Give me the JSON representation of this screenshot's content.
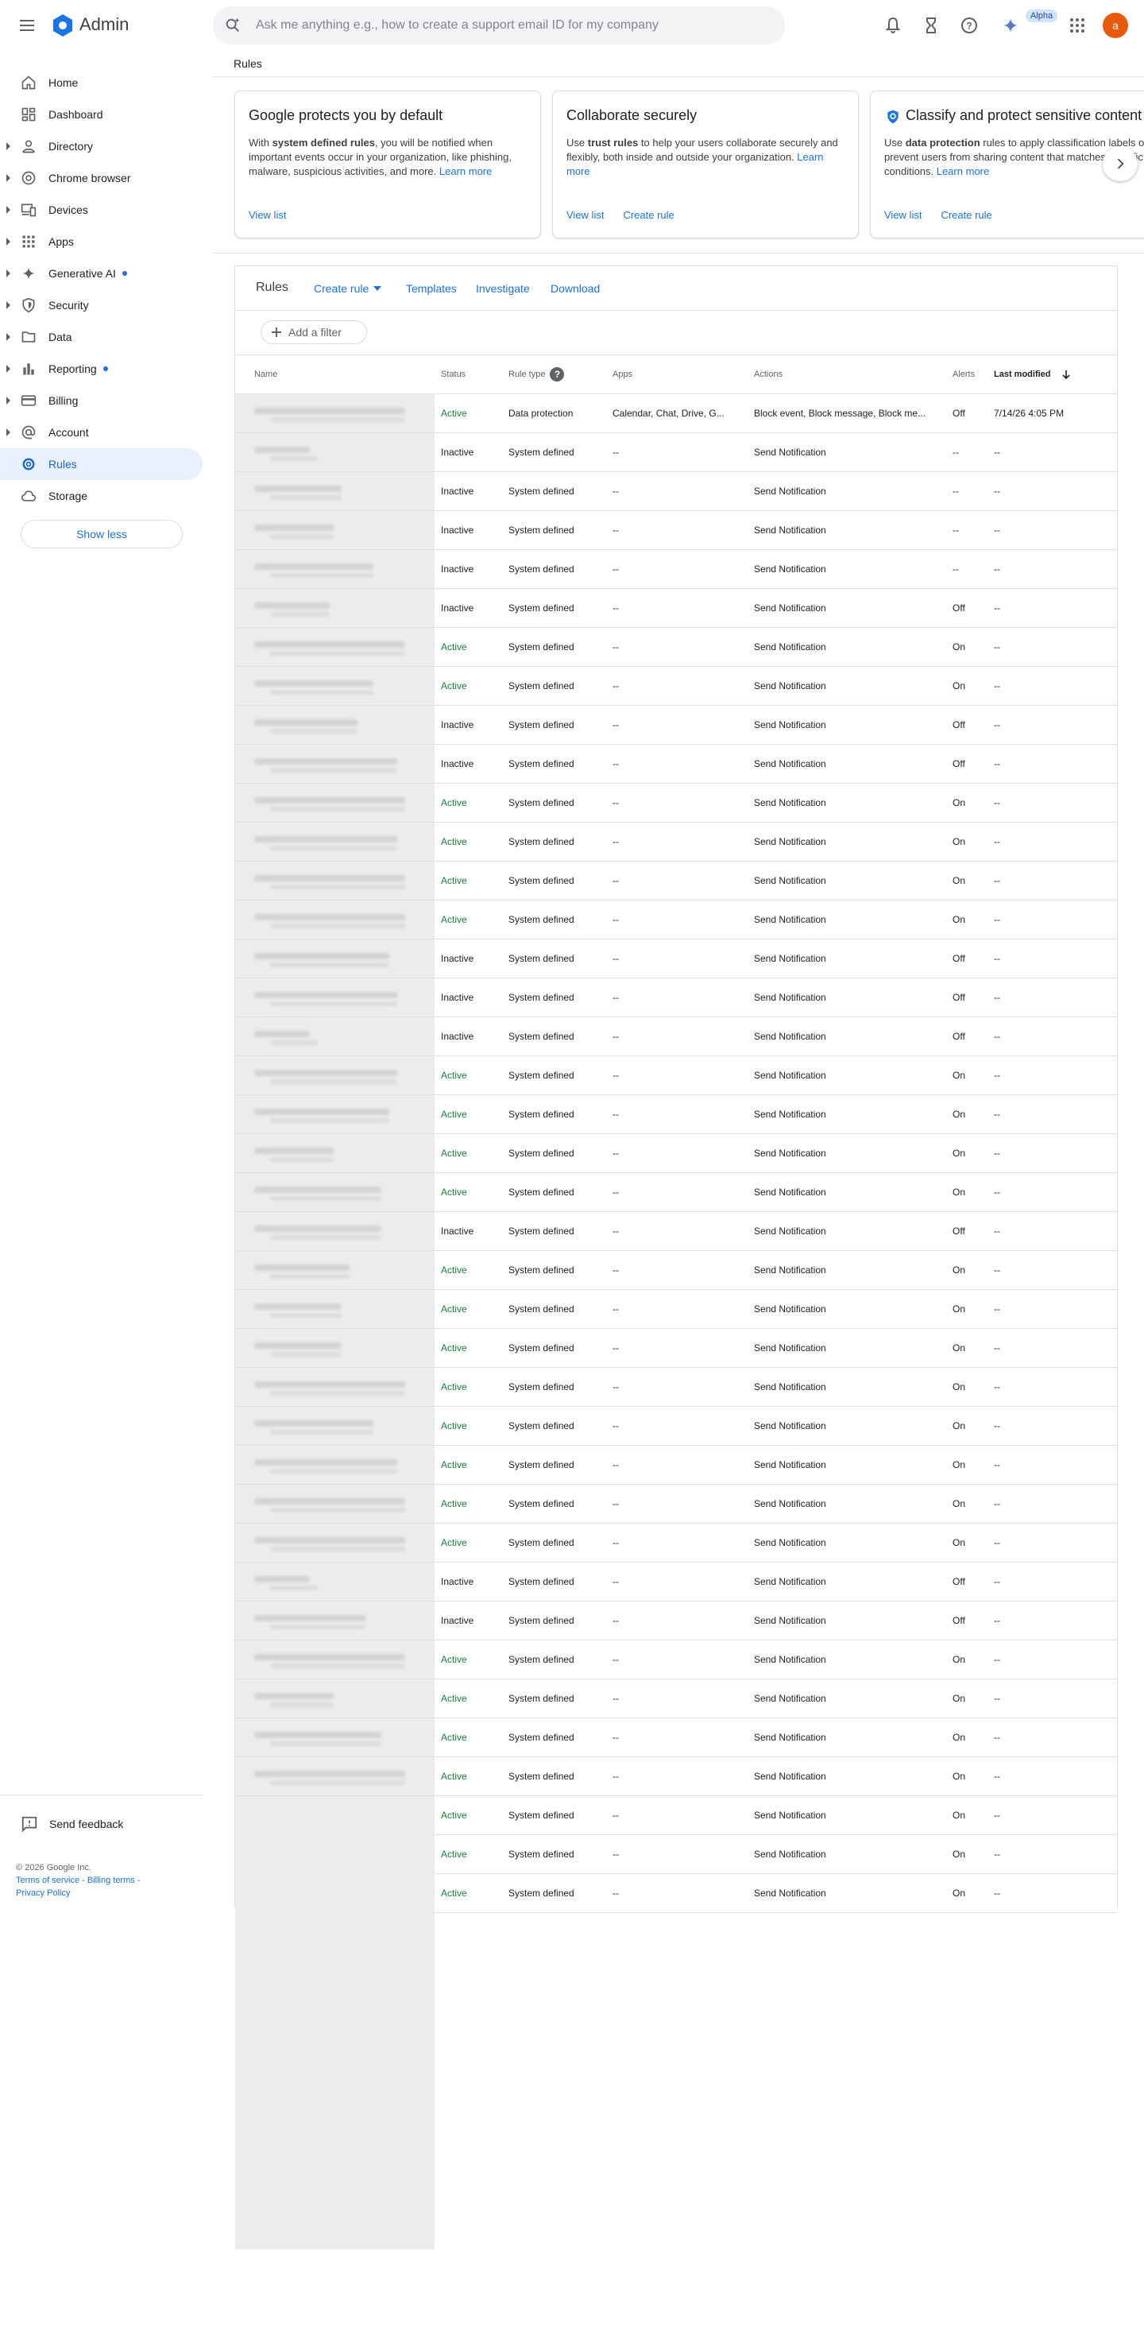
{
  "app": {
    "title": "Admin",
    "avatar_letter": "a",
    "alpha_badge": "Alpha"
  },
  "search": {
    "placeholder": "Ask me anything e.g., how to create a support email ID for my company"
  },
  "sidebar": {
    "items": [
      {
        "label": "Home",
        "icon": "home-icon",
        "caret": false,
        "dot": false,
        "active": false
      },
      {
        "label": "Dashboard",
        "icon": "dashboard-icon",
        "caret": false,
        "dot": false,
        "active": false
      },
      {
        "label": "Directory",
        "icon": "person-icon",
        "caret": true,
        "dot": false,
        "active": false
      },
      {
        "label": "Chrome browser",
        "icon": "chrome-icon",
        "caret": true,
        "dot": false,
        "active": false
      },
      {
        "label": "Devices",
        "icon": "devices-icon",
        "caret": true,
        "dot": false,
        "active": false
      },
      {
        "label": "Apps",
        "icon": "apps-grid-icon",
        "caret": true,
        "dot": false,
        "active": false
      },
      {
        "label": "Generative AI",
        "icon": "sparkle-icon",
        "caret": true,
        "dot": true,
        "active": false
      },
      {
        "label": "Security",
        "icon": "shield-icon",
        "caret": true,
        "dot": false,
        "active": false
      },
      {
        "label": "Data",
        "icon": "folder-icon",
        "caret": true,
        "dot": false,
        "active": false
      },
      {
        "label": "Reporting",
        "icon": "bar-chart-icon",
        "caret": true,
        "dot": true,
        "active": false
      },
      {
        "label": "Billing",
        "icon": "credit-card-icon",
        "caret": true,
        "dot": false,
        "active": false
      },
      {
        "label": "Account",
        "icon": "at-sign-icon",
        "caret": true,
        "dot": false,
        "active": false
      },
      {
        "label": "Rules",
        "icon": "rules-icon",
        "caret": false,
        "dot": false,
        "active": true
      },
      {
        "label": "Storage",
        "icon": "cloud-icon",
        "caret": false,
        "dot": false,
        "active": false
      }
    ],
    "show_less": "Show less",
    "send_feedback": "Send feedback",
    "footer": {
      "copyright": "© 2026 Google Inc.",
      "terms": "Terms of service",
      "billing_terms": "Billing terms",
      "privacy": "Privacy Policy",
      "sep": " - "
    }
  },
  "breadcrumb": "Rules",
  "cards": [
    {
      "title": "Google protects you by default",
      "pre": "With ",
      "bold": "system defined rules",
      "post": ", you will be notified when important events occur in your organization, like phishing, malware, suspicious activities, and more. ",
      "learn_more": "Learn more",
      "links": [
        "View list"
      ]
    },
    {
      "title": "Collaborate securely",
      "pre": "Use ",
      "bold": "trust rules",
      "post": " to help your users collaborate securely and flexibly, both inside and outside your organization. ",
      "learn_more": "Learn more",
      "links": [
        "View list",
        "Create rule"
      ]
    },
    {
      "title": "Classify and protect sensitive content",
      "pre": "Use ",
      "bold": "data protection",
      "post": " rules to apply classification labels or prevent users from sharing content that matches specific conditions. ",
      "learn_more": "Learn more",
      "links": [
        "View list",
        "Create rule"
      ]
    }
  ],
  "toolbar": {
    "title": "Rules",
    "create_rule": "Create rule",
    "templates": "Templates",
    "investigate": "Investigate",
    "download": "Download"
  },
  "filter": {
    "label": "Add a filter"
  },
  "table": {
    "headers": {
      "name": "Name",
      "status": "Status",
      "rule_type": "Rule type",
      "apps": "Apps",
      "actions": "Actions",
      "alerts": "Alerts",
      "last_modified": "Last modified"
    },
    "rows": [
      {
        "status": "Active",
        "type": "Data protection",
        "apps": "Calendar, Chat, Drive, G...",
        "actions": "Block event, Block message, Block me...",
        "alerts": "Off",
        "modified": "7/14/26 4:05 PM"
      },
      {
        "status": "Inactive",
        "type": "System defined",
        "apps": "--",
        "actions": "Send Notification",
        "alerts": "--",
        "modified": "--"
      },
      {
        "status": "Inactive",
        "type": "System defined",
        "apps": "--",
        "actions": "Send Notification",
        "alerts": "--",
        "modified": "--"
      },
      {
        "status": "Inactive",
        "type": "System defined",
        "apps": "--",
        "actions": "Send Notification",
        "alerts": "--",
        "modified": "--"
      },
      {
        "status": "Inactive",
        "type": "System defined",
        "apps": "--",
        "actions": "Send Notification",
        "alerts": "--",
        "modified": "--"
      },
      {
        "status": "Inactive",
        "type": "System defined",
        "apps": "--",
        "actions": "Send Notification",
        "alerts": "Off",
        "modified": "--"
      },
      {
        "status": "Active",
        "type": "System defined",
        "apps": "--",
        "actions": "Send Notification",
        "alerts": "On",
        "modified": "--"
      },
      {
        "status": "Active",
        "type": "System defined",
        "apps": "--",
        "actions": "Send Notification",
        "alerts": "On",
        "modified": "--"
      },
      {
        "status": "Inactive",
        "type": "System defined",
        "apps": "--",
        "actions": "Send Notification",
        "alerts": "Off",
        "modified": "--"
      },
      {
        "status": "Inactive",
        "type": "System defined",
        "apps": "--",
        "actions": "Send Notification",
        "alerts": "Off",
        "modified": "--"
      },
      {
        "status": "Active",
        "type": "System defined",
        "apps": "--",
        "actions": "Send Notification",
        "alerts": "On",
        "modified": "--"
      },
      {
        "status": "Active",
        "type": "System defined",
        "apps": "--",
        "actions": "Send Notification",
        "alerts": "On",
        "modified": "--"
      },
      {
        "status": "Active",
        "type": "System defined",
        "apps": "--",
        "actions": "Send Notification",
        "alerts": "On",
        "modified": "--"
      },
      {
        "status": "Active",
        "type": "System defined",
        "apps": "--",
        "actions": "Send Notification",
        "alerts": "On",
        "modified": "--"
      },
      {
        "status": "Inactive",
        "type": "System defined",
        "apps": "--",
        "actions": "Send Notification",
        "alerts": "Off",
        "modified": "--"
      },
      {
        "status": "Inactive",
        "type": "System defined",
        "apps": "--",
        "actions": "Send Notification",
        "alerts": "Off",
        "modified": "--"
      },
      {
        "status": "Inactive",
        "type": "System defined",
        "apps": "--",
        "actions": "Send Notification",
        "alerts": "Off",
        "modified": "--"
      },
      {
        "status": "Active",
        "type": "System defined",
        "apps": "--",
        "actions": "Send Notification",
        "alerts": "On",
        "modified": "--"
      },
      {
        "status": "Active",
        "type": "System defined",
        "apps": "--",
        "actions": "Send Notification",
        "alerts": "On",
        "modified": "--"
      },
      {
        "status": "Active",
        "type": "System defined",
        "apps": "--",
        "actions": "Send Notification",
        "alerts": "On",
        "modified": "--"
      },
      {
        "status": "Active",
        "type": "System defined",
        "apps": "--",
        "actions": "Send Notification",
        "alerts": "On",
        "modified": "--"
      },
      {
        "status": "Inactive",
        "type": "System defined",
        "apps": "--",
        "actions": "Send Notification",
        "alerts": "Off",
        "modified": "--"
      },
      {
        "status": "Active",
        "type": "System defined",
        "apps": "--",
        "actions": "Send Notification",
        "alerts": "On",
        "modified": "--"
      },
      {
        "status": "Active",
        "type": "System defined",
        "apps": "--",
        "actions": "Send Notification",
        "alerts": "On",
        "modified": "--"
      },
      {
        "status": "Active",
        "type": "System defined",
        "apps": "--",
        "actions": "Send Notification",
        "alerts": "On",
        "modified": "--"
      },
      {
        "status": "Active",
        "type": "System defined",
        "apps": "--",
        "actions": "Send Notification",
        "alerts": "On",
        "modified": "--"
      },
      {
        "status": "Active",
        "type": "System defined",
        "apps": "--",
        "actions": "Send Notification",
        "alerts": "On",
        "modified": "--"
      },
      {
        "status": "Active",
        "type": "System defined",
        "apps": "--",
        "actions": "Send Notification",
        "alerts": "On",
        "modified": "--"
      },
      {
        "status": "Active",
        "type": "System defined",
        "apps": "--",
        "actions": "Send Notification",
        "alerts": "On",
        "modified": "--"
      },
      {
        "status": "Active",
        "type": "System defined",
        "apps": "--",
        "actions": "Send Notification",
        "alerts": "On",
        "modified": "--"
      },
      {
        "status": "Inactive",
        "type": "System defined",
        "apps": "--",
        "actions": "Send Notification",
        "alerts": "Off",
        "modified": "--"
      },
      {
        "status": "Inactive",
        "type": "System defined",
        "apps": "--",
        "actions": "Send Notification",
        "alerts": "Off",
        "modified": "--"
      },
      {
        "status": "Active",
        "type": "System defined",
        "apps": "--",
        "actions": "Send Notification",
        "alerts": "On",
        "modified": "--"
      },
      {
        "status": "Active",
        "type": "System defined",
        "apps": "--",
        "actions": "Send Notification",
        "alerts": "On",
        "modified": "--"
      },
      {
        "status": "Active",
        "type": "System defined",
        "apps": "--",
        "actions": "Send Notification",
        "alerts": "On",
        "modified": "--"
      },
      {
        "status": "Active",
        "type": "System defined",
        "apps": "--",
        "actions": "Send Notification",
        "alerts": "On",
        "modified": "--"
      },
      {
        "status": "Active",
        "type": "System defined",
        "apps": "--",
        "actions": "Send Notification",
        "alerts": "On",
        "modified": "--"
      },
      {
        "status": "Active",
        "type": "System defined",
        "apps": "--",
        "actions": "Send Notification",
        "alerts": "On",
        "modified": "--"
      },
      {
        "status": "Active",
        "type": "System defined",
        "apps": "--",
        "actions": "Send Notification",
        "alerts": "On",
        "modified": "--"
      }
    ]
  },
  "colors": {
    "accent": "#1a73e8",
    "active_status": "#188038",
    "avatar_bg": "#e8590c",
    "selected_nav_bg": "#e8f0fe"
  }
}
